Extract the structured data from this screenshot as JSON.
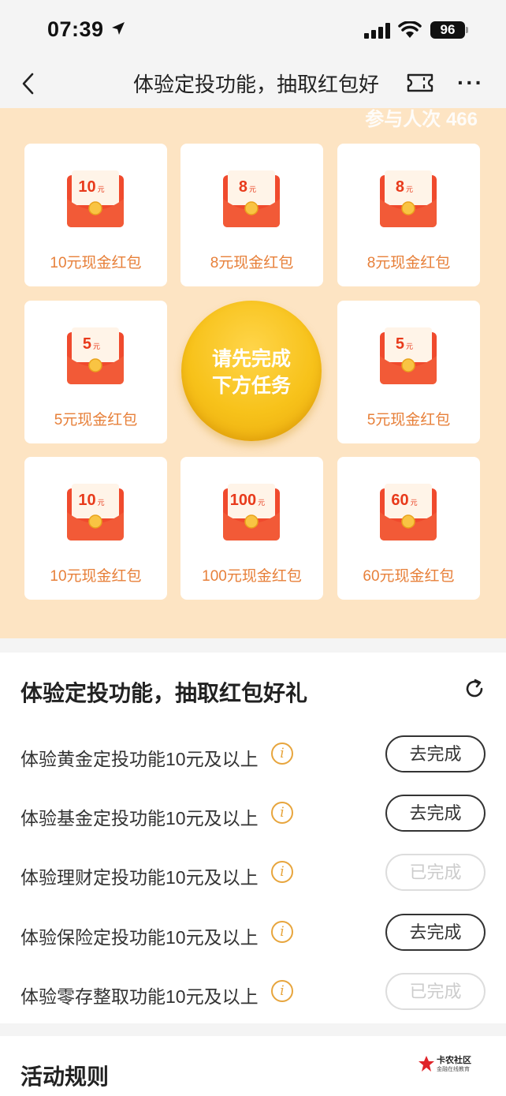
{
  "status_bar": {
    "time": "07:39",
    "battery": "96"
  },
  "nav": {
    "title": "体验定投功能，抽取红包好"
  },
  "lottery": {
    "participants": "参与人次 466",
    "center_button": {
      "line1": "请先完成",
      "line2": "下方任务"
    },
    "prizes": [
      {
        "amount": "10",
        "unit": "元",
        "label": "10元现金红包"
      },
      {
        "amount": "8",
        "unit": "元",
        "label": "8元现金红包"
      },
      {
        "amount": "8",
        "unit": "元",
        "label": "8元现金红包"
      },
      {
        "amount": "5",
        "unit": "元",
        "label": "5元现金红包"
      },
      {
        "amount": "5",
        "unit": "元",
        "label": "5元现金红包"
      },
      {
        "amount": "10",
        "unit": "元",
        "label": "10元现金红包"
      },
      {
        "amount": "100",
        "unit": "元",
        "label": "100元现金红包"
      },
      {
        "amount": "60",
        "unit": "元",
        "label": "60元现金红包"
      }
    ]
  },
  "tasks": {
    "title": "体验定投功能，抽取红包好礼",
    "info_glyph": "i",
    "items": [
      {
        "label": "体验黄金定投功能10元及以上",
        "button": "去完成",
        "done": false
      },
      {
        "label": "体验基金定投功能10元及以上",
        "button": "去完成",
        "done": false
      },
      {
        "label": "体验理财定投功能10元及以上",
        "button": "已完成",
        "done": true
      },
      {
        "label": "体验保险定投功能10元及以上",
        "button": "去完成",
        "done": false
      },
      {
        "label": "体验零存整取功能10元及以上",
        "button": "已完成",
        "done": true
      }
    ]
  },
  "rules": {
    "title": "活动规则",
    "watermark_line1": "卡农社区",
    "watermark_line2": "金融在线教育"
  },
  "colors": {
    "panel_bg": "#fde4c3",
    "prize_label": "#e7803a",
    "envelope_red": "#f04a2d",
    "gold_button": "#f7c21a",
    "info_icon": "#e7a53d"
  }
}
